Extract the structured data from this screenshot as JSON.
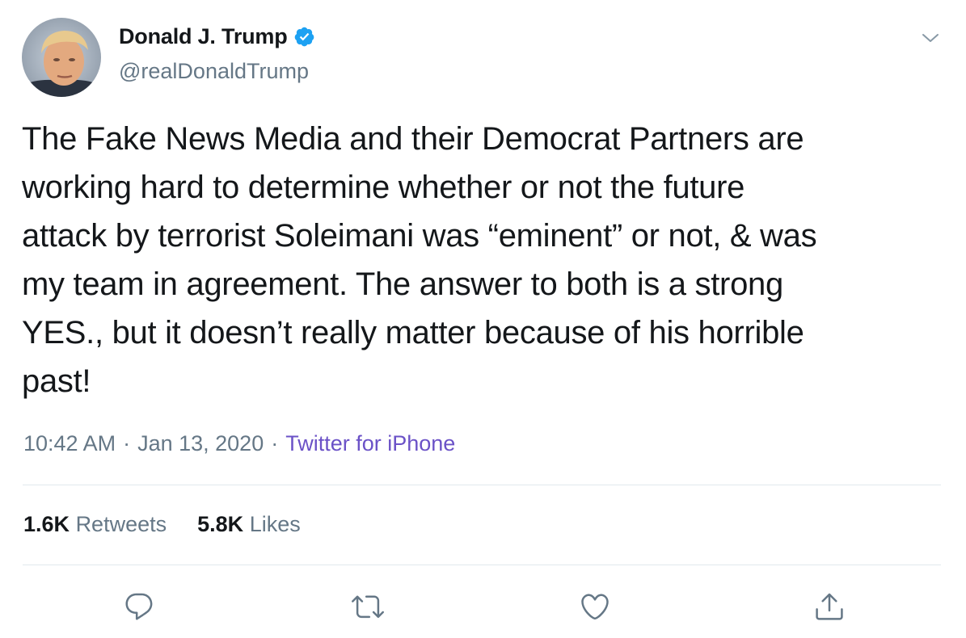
{
  "tweet": {
    "author": {
      "display_name": "Donald J. Trump",
      "handle": "@realDonaldTrump",
      "verified": true
    },
    "text_lines": [
      "The Fake News Media and their Democrat Partners are",
      "working hard to determine whether or not the future",
      "attack by terrorist Soleimani was “eminent” or not, & was",
      "my team in agreement. The answer to both is a strong",
      "YES., but it doesn’t really matter because of his horrible",
      "past!"
    ],
    "time": "10:42 AM",
    "date": "Jan 13, 2020",
    "separator": "·",
    "source": "Twitter for iPhone",
    "stats": {
      "retweets_count": "1.6K",
      "retweets_label": "Retweets",
      "likes_count": "5.8K",
      "likes_label": "Likes"
    },
    "icons": {
      "caret": "chevron-down-icon",
      "reply": "reply-icon",
      "retweet": "retweet-icon",
      "like": "heart-icon",
      "share": "share-icon"
    }
  },
  "colors": {
    "text": "#14171a",
    "secondary": "#657786",
    "source_link": "#6b52c7",
    "verified_badge": "#1da1f2",
    "divider": "#e1e8ed",
    "icon": "#657786"
  }
}
